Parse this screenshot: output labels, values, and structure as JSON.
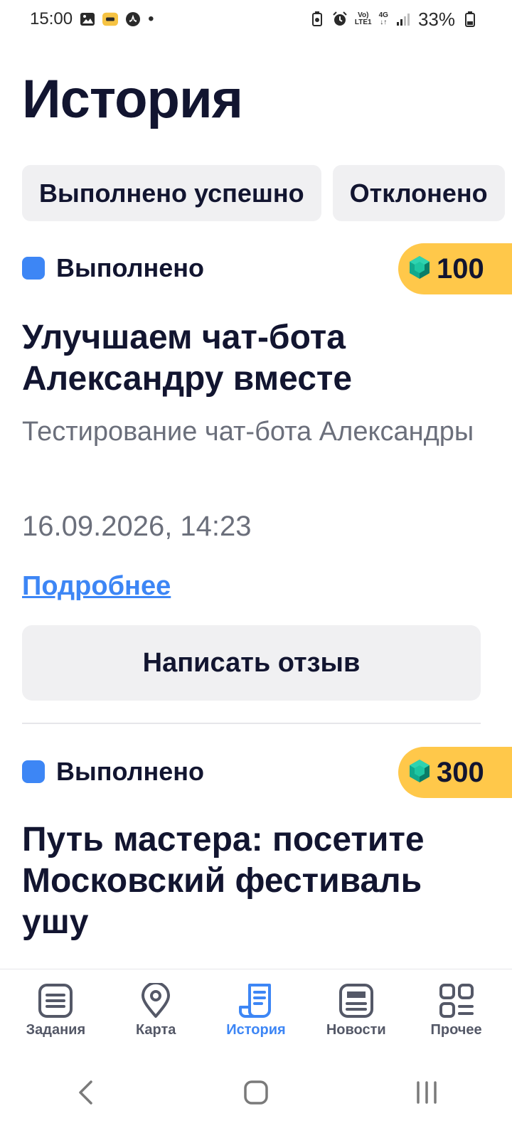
{
  "status_bar": {
    "time": "15:00",
    "dot": "•",
    "network_top": "Vo)",
    "network_bottom": "LTE1",
    "network_type": "4G",
    "battery": "33%"
  },
  "page": {
    "title": "История"
  },
  "filters": [
    {
      "label": "Выполнено успешно"
    },
    {
      "label": "Отклонено"
    }
  ],
  "tasks": [
    {
      "status": "Выполнено",
      "reward": "100",
      "title": "Улучшаем чат-бота Александру вместе",
      "subtitle": "Тестирование чат-бота Александры",
      "date": "16.09.2026, 14:23",
      "link": "Подробнее",
      "button": "Написать отзыв"
    },
    {
      "status": "Выполнено",
      "reward": "300",
      "title": "Путь мастера: посетите Московский фестиваль ушу"
    }
  ],
  "bottom_nav": [
    {
      "label": "Задания",
      "icon": "list-icon"
    },
    {
      "label": "Карта",
      "icon": "map-pin-icon"
    },
    {
      "label": "История",
      "icon": "history-scroll-icon",
      "active": true
    },
    {
      "label": "Новости",
      "icon": "news-icon"
    },
    {
      "label": "Прочее",
      "icon": "grid-icon"
    }
  ],
  "colors": {
    "accent": "#3d86f5",
    "reward_bg": "#ffc84a",
    "chip_bg": "#f0f0f2",
    "text_primary": "#121530",
    "text_secondary": "#6b6f7b"
  }
}
